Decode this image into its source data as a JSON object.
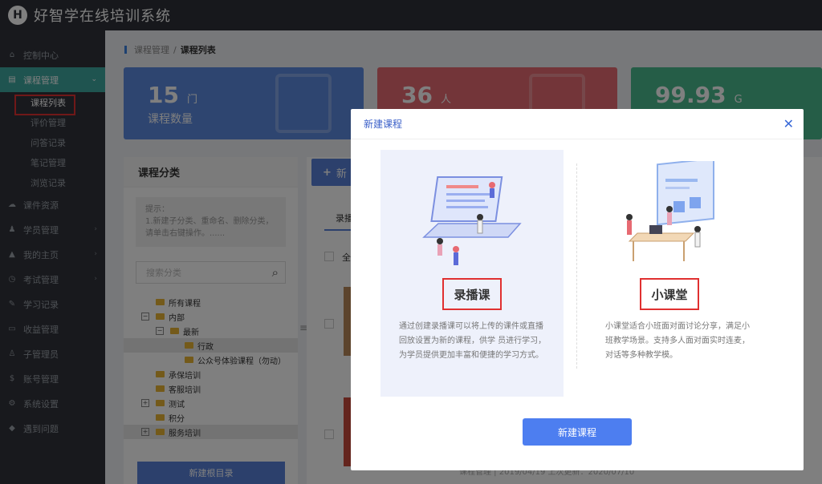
{
  "header": {
    "logo_letter": "H",
    "title": "好智学在线培训系统"
  },
  "sidebar": {
    "items": [
      {
        "label": "控制中心",
        "icon": "home-icon"
      },
      {
        "label": "课程管理",
        "icon": "book-icon",
        "active": true
      },
      {
        "label": "课件资源",
        "icon": "cloud-icon"
      },
      {
        "label": "学员管理",
        "icon": "users-icon"
      },
      {
        "label": "我的主页",
        "icon": "graduation-icon"
      },
      {
        "label": "考试管理",
        "icon": "clock-icon"
      },
      {
        "label": "学习记录",
        "icon": "edit-icon"
      },
      {
        "label": "收益管理",
        "icon": "card-icon"
      },
      {
        "label": "子管理员",
        "icon": "admin-icon"
      },
      {
        "label": "账号管理",
        "icon": "dollar-icon"
      },
      {
        "label": "系统设置",
        "icon": "gear-icon"
      },
      {
        "label": "遇到问题",
        "icon": "help-icon"
      }
    ],
    "sub_items": [
      "课程列表",
      "评价管理",
      "问答记录",
      "笔记管理",
      "浏览记录"
    ]
  },
  "breadcrumb": {
    "parent": "课程管理",
    "separator": "/",
    "current": "课程列表"
  },
  "stats": [
    {
      "value": "15",
      "unit": "门",
      "label": "课程数量",
      "color": "#5c8ae0"
    },
    {
      "value": "36",
      "unit": "人",
      "label": "",
      "color": "#e76a72"
    },
    {
      "value": "99.93",
      "unit": "G",
      "label": "",
      "color": "#4bbb8e"
    }
  ],
  "category_panel": {
    "title": "课程分类",
    "hint": "提示：\n1.新建子分类、重命名、删除分类，请单击右键操作。......",
    "search_placeholder": "搜索分类",
    "tree": [
      {
        "label": "所有课程",
        "toggle": ""
      },
      {
        "label": "内部",
        "toggle": "−"
      },
      {
        "label": "最新",
        "toggle": "−"
      },
      {
        "label": "行政",
        "toggle": ""
      },
      {
        "label": "公众号体验课程（勿动）",
        "toggle": ""
      },
      {
        "label": "承保培训",
        "toggle": ""
      },
      {
        "label": "客服培训",
        "toggle": ""
      },
      {
        "label": "测试",
        "toggle": "+"
      },
      {
        "label": "积分",
        "toggle": ""
      },
      {
        "label": "服务培训",
        "toggle": "+"
      }
    ],
    "new_dir_button": "新建根目录"
  },
  "right_pane": {
    "add_button": "新",
    "tab_label": "录播",
    "select_all": "全",
    "footer": "课程管理 | 2019/04/19 上次更新：2020/07/10"
  },
  "modal": {
    "title": "新建课程",
    "options": [
      {
        "title": "录播课",
        "desc": "通过创建录播课可以将上传的课件或直播回放设置为新的课程，供学 员进行学习，为学员提供更加丰富和便捷的学习方式。"
      },
      {
        "title": "小课堂",
        "desc": "小课堂适合小班面对面讨论分享，满足小班教学场景。支持多人面对面实时连麦，对话等多种教学模。"
      }
    ],
    "confirm_button": "新建课程"
  }
}
